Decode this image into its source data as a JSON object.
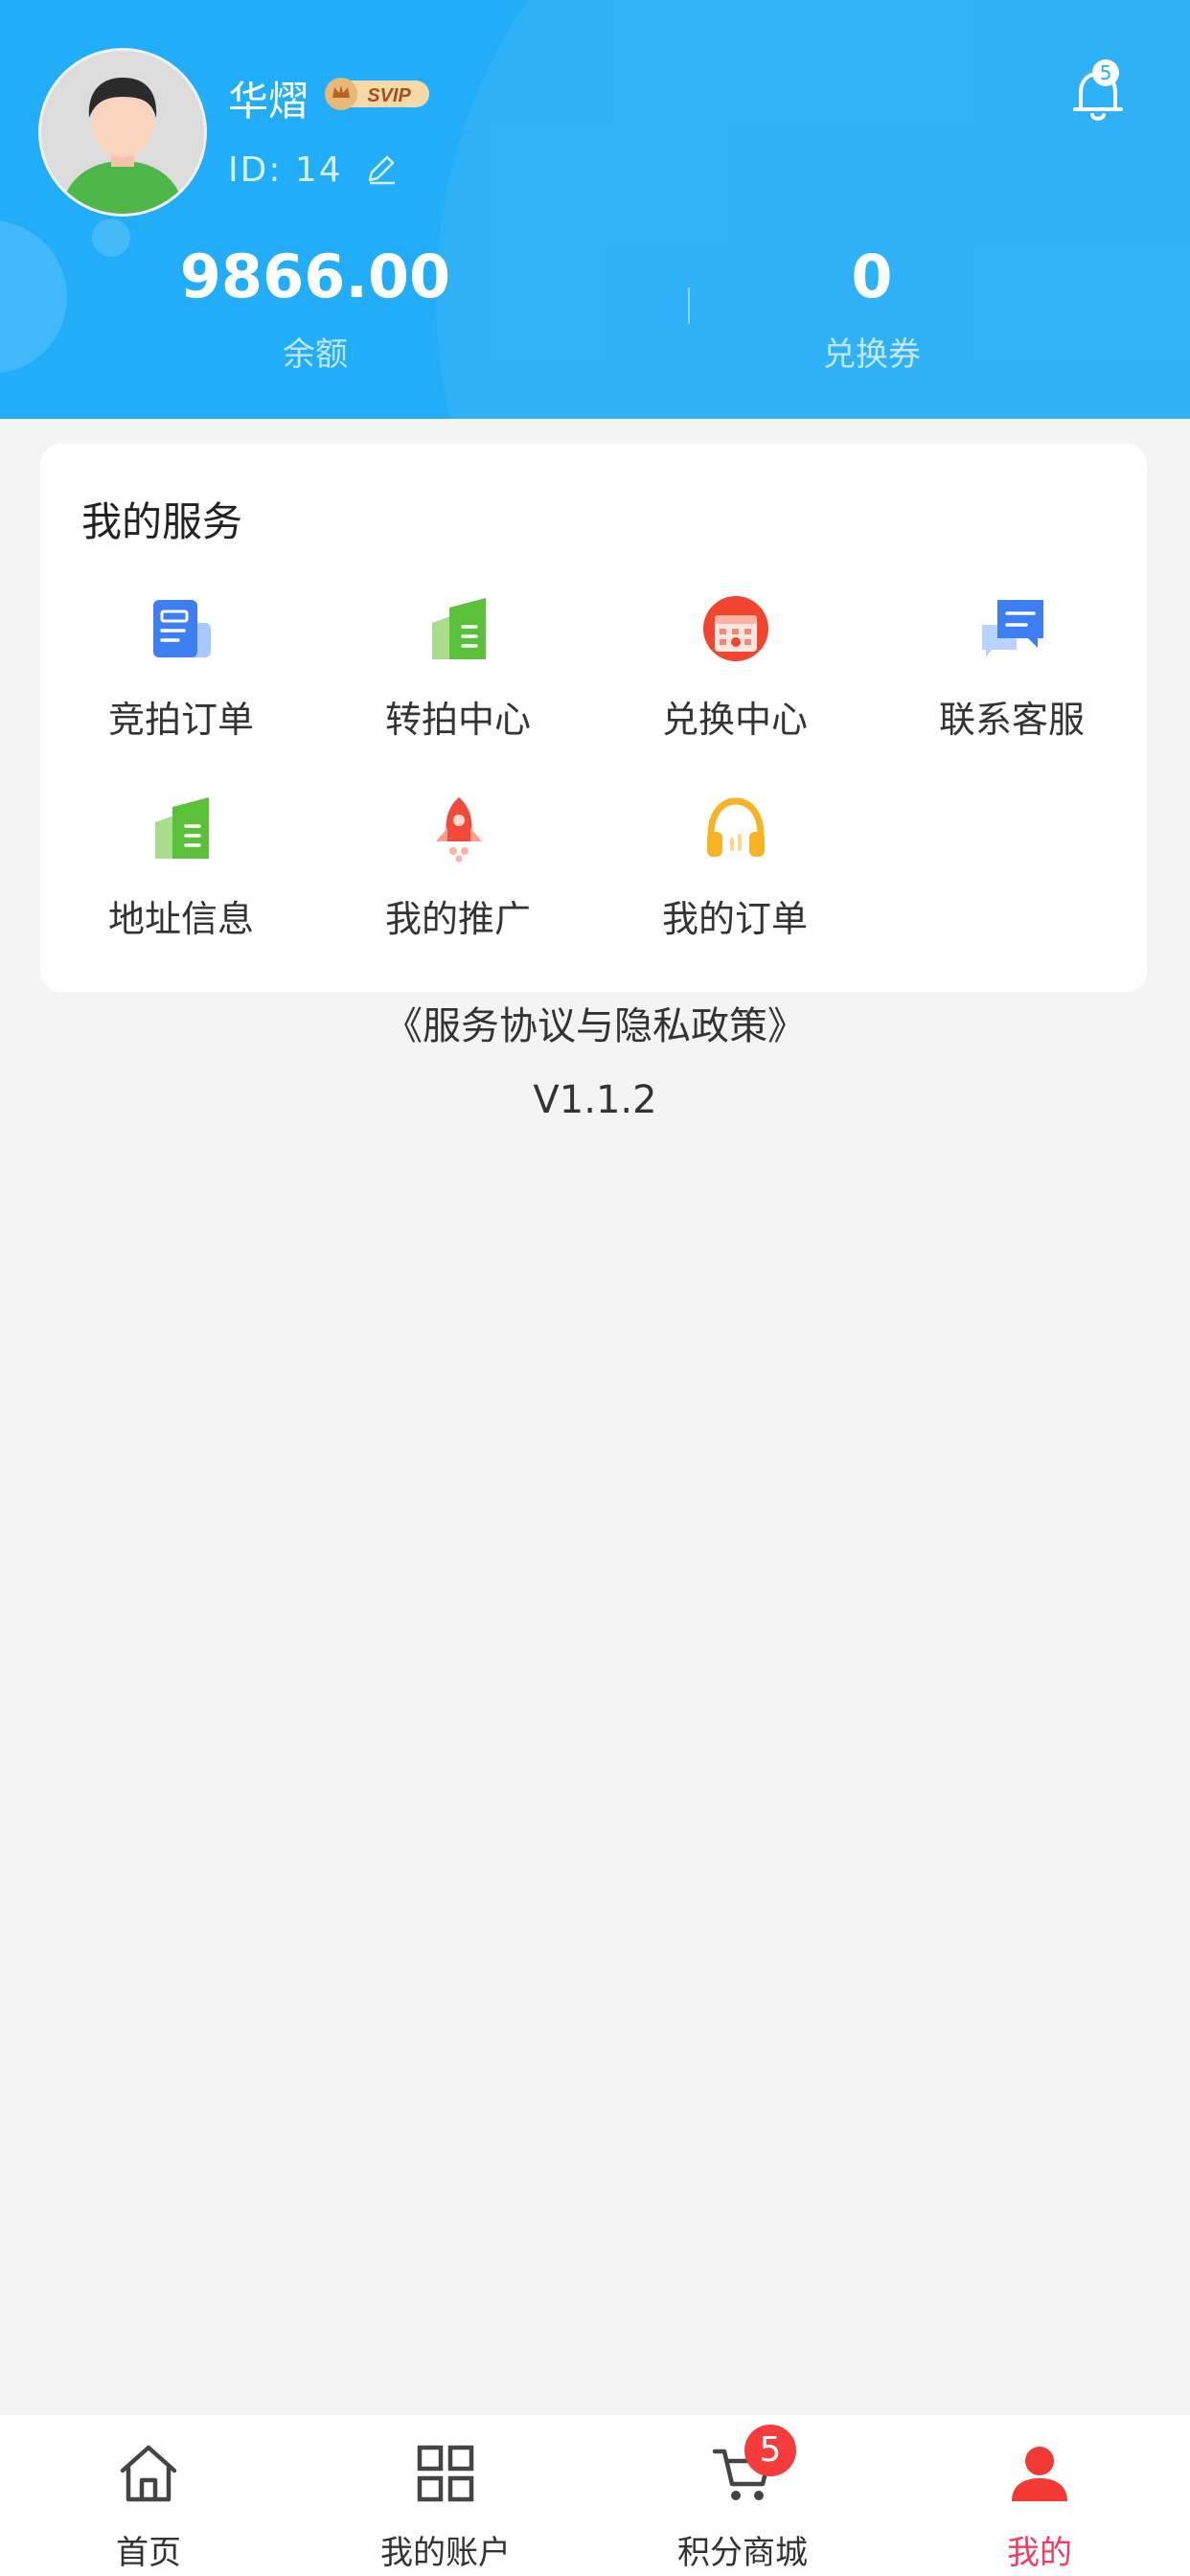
{
  "header": {
    "username": "华熠",
    "vip_label": "SVIP",
    "user_id": "ID: 14",
    "notification_count": "5",
    "background_color": "#22adf8",
    "stats": [
      {
        "value": "9866.00",
        "label": "余额"
      },
      {
        "value": "0",
        "label": "兑换券"
      }
    ]
  },
  "services": {
    "title": "我的服务",
    "items": [
      {
        "label": "竞拍订单",
        "icon": "document-icon"
      },
      {
        "label": "转拍中心",
        "icon": "building-icon"
      },
      {
        "label": "兑换中心",
        "icon": "calendar-icon"
      },
      {
        "label": "联系客服",
        "icon": "chat-icon"
      },
      {
        "label": "地址信息",
        "icon": "building-icon"
      },
      {
        "label": "我的推广",
        "icon": "rocket-icon"
      },
      {
        "label": "我的订单",
        "icon": "headphones-icon"
      }
    ]
  },
  "agreement_link": "《服务协议与隐私政策》",
  "version": "V1.1.2",
  "tabbar": {
    "active_color": "#f23a63",
    "cart_badge": "5",
    "items": [
      {
        "label": "首页",
        "icon": "home-icon"
      },
      {
        "label": "我的账户",
        "icon": "grid-icon"
      },
      {
        "label": "积分商城",
        "icon": "cart-icon"
      },
      {
        "label": "我的",
        "icon": "user-icon"
      }
    ]
  }
}
